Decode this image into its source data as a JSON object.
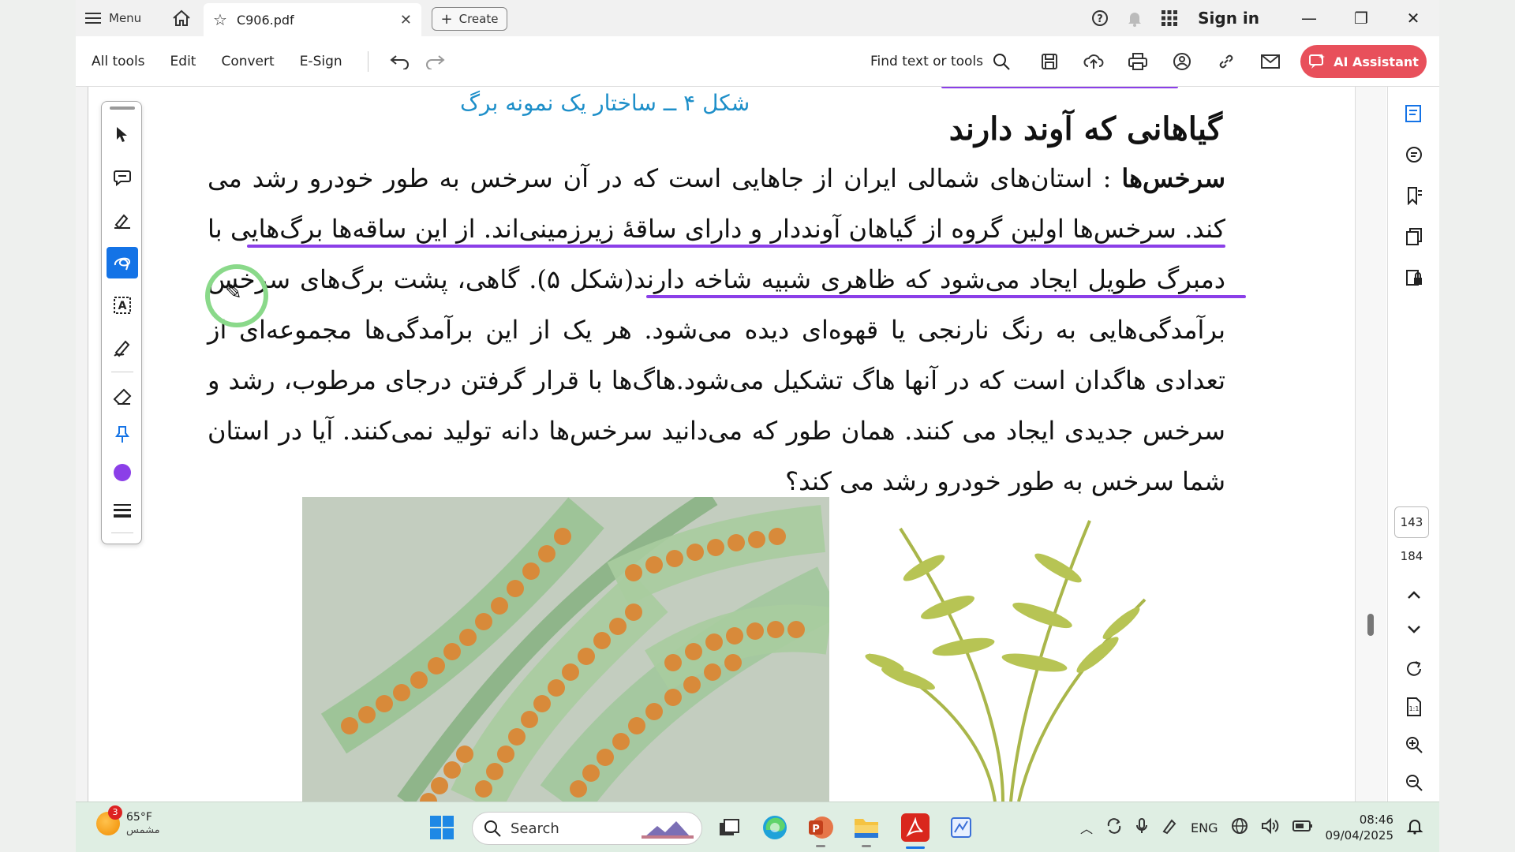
{
  "titlebar": {
    "menu_label": "Menu",
    "tab_title": "C906.pdf",
    "create_label": "Create",
    "signin_label": "Sign in"
  },
  "toolbar": {
    "items": [
      "All tools",
      "Edit",
      "Convert",
      "E-Sign"
    ],
    "find_label": "Find text or tools",
    "ai_label": "AI Assistant"
  },
  "page_nav": {
    "current_page": "143",
    "total_pages": "184"
  },
  "document": {
    "figure_caption": "شکل ۴ ــ ساختار یک نمونه برگ",
    "heading": "گیاهانی که آوند دارند",
    "para_term": "سرخس‌ها",
    "para_text": " : استان‌های شمالی ایران از جاهایی است که در آن سرخس به طور خودرو رشد می کند. سرخس‌ها اولین گروه از گیاهان آونددار و دارای ساقهٔ زیرزمینی‌اند. از این ساقه‌ها برگ‌هایی با دمبرگ طویل ایجاد می‌شود که ظاهری شبیه شاخه دارند(شکل ۵). گاهی، پشت برگ‌های سرخس برآمدگی‌هایی به رنگ نارنجی یا قهوه‌ای دیده می‌شود. هر یک از این برآمدگی‌ها مجموعه‌ای از تعدادی هاگدان است که در آنها هاگ تشکیل می‌شود.هاگ‌ها با قرار گرفتن درجای مرطوب، رشد و سرخس جدیدی ایجاد می کنند. همان طور که می‌دانید سرخس‌ها دانه تولید نمی‌کنند. آیا در استان شما سرخس به طور خودرو رشد می کند؟"
  },
  "taskbar": {
    "weather_temp": "65°F",
    "weather_desc": "مشمس",
    "weather_badge": "3",
    "search_placeholder": "Search",
    "lang": "ENG",
    "time": "08:46",
    "date": "09/04/2025"
  },
  "colors": {
    "annotation_purple": "#8b3fe8",
    "ai_button": "#e8505b",
    "active_tool": "#1473e6",
    "caption_blue": "#1e8fc9"
  }
}
